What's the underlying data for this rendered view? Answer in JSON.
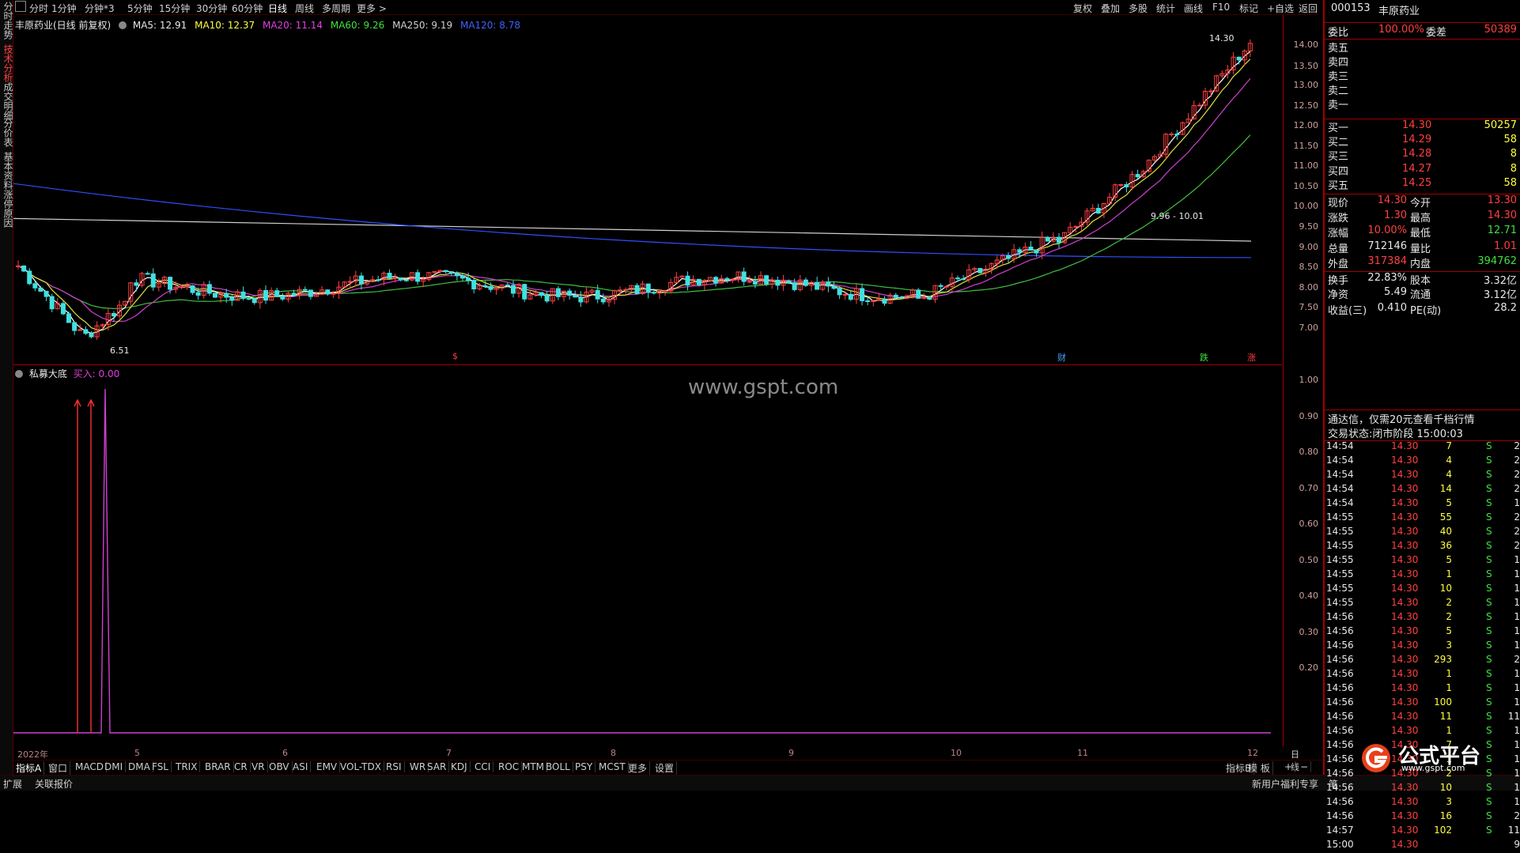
{
  "left_tabs": [
    "分时走势",
    "技术分析",
    "成交明细",
    "分价表",
    "基本资料",
    "涨停原因"
  ],
  "periods": [
    "分时",
    "1分钟",
    "分钟*3",
    "5分钟",
    "15分钟",
    "30分钟",
    "60分钟",
    "日线",
    "周线",
    "多周期",
    "更多 >"
  ],
  "toolbar_right": [
    "复权",
    "叠加",
    "多股",
    "统计",
    "画线",
    "F10",
    "标记",
    "+自选",
    "返回"
  ],
  "main_legend": {
    "title": "丰原药业(日线 前复权)",
    "ma5": "MA5: 12.91",
    "ma10": "MA10: 12.37",
    "ma20": "MA20: 11.14",
    "ma60": "MA60: 9.26",
    "ma250": "MA250: 9.19",
    "ma120": "MA120: 8.78"
  },
  "price_axis": [
    "14.00",
    "13.50",
    "13.00",
    "12.50",
    "12.00",
    "11.50",
    "11.00",
    "10.50",
    "10.00",
    "9.50",
    "9.00",
    "8.50",
    "8.00",
    "7.50",
    "7.00"
  ],
  "annotations": {
    "high": "14.30",
    "low": "6.51",
    "range": "9.96 - 10.01"
  },
  "event_marks": [
    {
      "label": "$",
      "color": "#ff4040"
    },
    {
      "label": "财",
      "color": "#40a0ff"
    },
    {
      "label": "跌",
      "color": "#40e040"
    },
    {
      "label": "涨",
      "color": "#ff4040"
    }
  ],
  "ind_legend": {
    "name": "私募大底",
    "buy": "买入: 0.00"
  },
  "ind_axis": [
    "1.00",
    "0.90",
    "0.80",
    "0.70",
    "0.60",
    "0.50",
    "0.40",
    "0.30",
    "0.20"
  ],
  "dates": [
    "2022年",
    "5",
    "6",
    "7",
    "8",
    "9",
    "10",
    "11",
    "12"
  ],
  "date_right": "日线",
  "indicator_tabs": [
    "指标A",
    "窗口",
    "MACD",
    "DMI",
    "DMA",
    "FSL",
    "TRIX",
    "BRAR",
    "CR",
    "VR",
    "OBV",
    "ASI",
    "EMV",
    "VOL-TDX",
    "RSI",
    "WR",
    "SAR",
    "KDJ",
    "CCI",
    "ROC",
    "MTM",
    "BOLL",
    "PSY",
    "MCST",
    "更多",
    "设置"
  ],
  "ind_tabs_right": [
    "指标B",
    "模 板",
    "+",
    "−"
  ],
  "status_bar": {
    "left1": "扩展",
    "left2": "关联报价",
    "right": "新用户福利专享",
    "right2": "笔"
  },
  "watermark": "www.gspt.com",
  "logo": {
    "text": "公式平台",
    "url": "www.gspt.com"
  },
  "stock": {
    "code": "000153",
    "name": "丰原药业"
  },
  "quote_top": {
    "weibi_label": "委比",
    "weibi": "100.00%",
    "weicha_label": "委差",
    "weicha": "50389"
  },
  "sell_levels": [
    "卖五",
    "卖四",
    "卖三",
    "卖二",
    "卖一"
  ],
  "buy_levels": [
    {
      "label": "买一",
      "price": "14.30",
      "vol": "50257"
    },
    {
      "label": "买二",
      "price": "14.29",
      "vol": "58"
    },
    {
      "label": "买三",
      "price": "14.28",
      "vol": "8"
    },
    {
      "label": "买四",
      "price": "14.27",
      "vol": "8"
    },
    {
      "label": "买五",
      "price": "14.25",
      "vol": "58"
    }
  ],
  "stats": [
    {
      "l1": "现价",
      "v1": "14.30",
      "c1": "red",
      "l2": "今开",
      "v2": "13.30",
      "c2": "red"
    },
    {
      "l1": "涨跌",
      "v1": "1.30",
      "c1": "red",
      "l2": "最高",
      "v2": "14.30",
      "c2": "red"
    },
    {
      "l1": "涨幅",
      "v1": "10.00%",
      "c1": "red",
      "l2": "最低",
      "v2": "12.71",
      "c2": "green"
    },
    {
      "l1": "总量",
      "v1": "712146",
      "c1": "white",
      "l2": "量比",
      "v2": "1.01",
      "c2": "red"
    },
    {
      "l1": "外盘",
      "v1": "317384",
      "c1": "red",
      "l2": "内盘",
      "v2": "394762",
      "c2": "green"
    },
    {
      "l1": "换手",
      "v1": "22.83%",
      "c1": "white",
      "l2": "股本",
      "v2": "3.32亿",
      "c2": "white"
    },
    {
      "l1": "净资",
      "v1": "5.49",
      "c1": "white",
      "l2": "流通",
      "v2": "3.12亿",
      "c2": "white"
    },
    {
      "l1": "收益(三)",
      "v1": "0.410",
      "c1": "white",
      "l2": "PE(动)",
      "v2": "28.2",
      "c2": "white"
    }
  ],
  "notice": "通达信，仅需20元查看千档行情",
  "trade_state": "交易状态:闭市阶段 15:00:03",
  "ticks": [
    {
      "t": "14:54",
      "p": "14.30",
      "v": "7",
      "s": "S",
      "n": "2"
    },
    {
      "t": "14:54",
      "p": "14.30",
      "v": "4",
      "s": "S",
      "n": "2"
    },
    {
      "t": "14:54",
      "p": "14.30",
      "v": "4",
      "s": "S",
      "n": "2"
    },
    {
      "t": "14:54",
      "p": "14.30",
      "v": "14",
      "s": "S",
      "n": "2"
    },
    {
      "t": "14:54",
      "p": "14.30",
      "v": "5",
      "s": "S",
      "n": "1"
    },
    {
      "t": "14:55",
      "p": "14.30",
      "v": "55",
      "s": "S",
      "n": "2"
    },
    {
      "t": "14:55",
      "p": "14.30",
      "v": "40",
      "s": "S",
      "n": "2"
    },
    {
      "t": "14:55",
      "p": "14.30",
      "v": "36",
      "s": "S",
      "n": "2"
    },
    {
      "t": "14:55",
      "p": "14.30",
      "v": "5",
      "s": "S",
      "n": "1"
    },
    {
      "t": "14:55",
      "p": "14.30",
      "v": "1",
      "s": "S",
      "n": "1"
    },
    {
      "t": "14:55",
      "p": "14.30",
      "v": "10",
      "s": "S",
      "n": "1"
    },
    {
      "t": "14:55",
      "p": "14.30",
      "v": "2",
      "s": "S",
      "n": "1"
    },
    {
      "t": "14:56",
      "p": "14.30",
      "v": "2",
      "s": "S",
      "n": "1"
    },
    {
      "t": "14:56",
      "p": "14.30",
      "v": "5",
      "s": "S",
      "n": "1"
    },
    {
      "t": "14:56",
      "p": "14.30",
      "v": "3",
      "s": "S",
      "n": "1"
    },
    {
      "t": "14:56",
      "p": "14.30",
      "v": "293",
      "s": "S",
      "n": "2"
    },
    {
      "t": "14:56",
      "p": "14.30",
      "v": "1",
      "s": "S",
      "n": "1"
    },
    {
      "t": "14:56",
      "p": "14.30",
      "v": "1",
      "s": "S",
      "n": "1"
    },
    {
      "t": "14:56",
      "p": "14.30",
      "v": "100",
      "s": "S",
      "n": "1"
    },
    {
      "t": "14:56",
      "p": "14.30",
      "v": "11",
      "s": "S",
      "n": "11"
    },
    {
      "t": "14:56",
      "p": "14.30",
      "v": "1",
      "s": "S",
      "n": "1"
    },
    {
      "t": "14:56",
      "p": "14.30",
      "v": "7",
      "s": "S",
      "n": "1"
    },
    {
      "t": "14:56",
      "p": "14.30",
      "v": "1",
      "s": "S",
      "n": "1"
    },
    {
      "t": "14:56",
      "p": "14.30",
      "v": "2",
      "s": "S",
      "n": "1"
    },
    {
      "t": "14:56",
      "p": "14.30",
      "v": "10",
      "s": "S",
      "n": "1"
    },
    {
      "t": "14:56",
      "p": "14.30",
      "v": "3",
      "s": "S",
      "n": "1"
    },
    {
      "t": "14:56",
      "p": "14.30",
      "v": "16",
      "s": "S",
      "n": "2"
    },
    {
      "t": "14:57",
      "p": "14.30",
      "v": "102",
      "s": "S",
      "n": "11"
    },
    {
      "t": "15:00",
      "p": "14.30",
      "v": "",
      "s": "",
      "n": "9"
    }
  ]
}
